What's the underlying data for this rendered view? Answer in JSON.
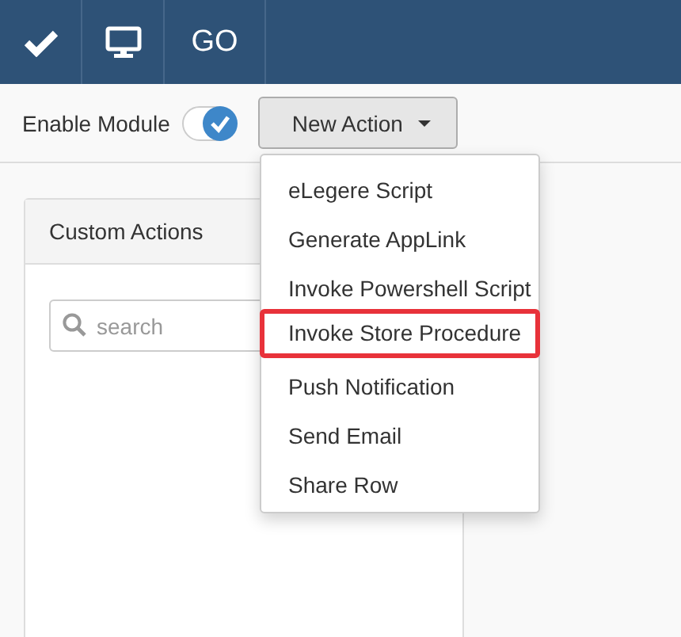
{
  "navbar": {
    "items": [
      {
        "kind": "check"
      },
      {
        "kind": "monitor"
      },
      {
        "kind": "text",
        "label": "GO"
      }
    ]
  },
  "toolbar": {
    "enable_label": "Enable Module",
    "enable_on": true,
    "new_action": "New Action"
  },
  "menu": {
    "items": [
      {
        "label": "eLegere Script",
        "highlighted": false
      },
      {
        "label": "Generate AppLink",
        "highlighted": false
      },
      {
        "label": "Invoke Powershell Script",
        "highlighted": false
      },
      {
        "label": "Invoke Store Procedure",
        "highlighted": true
      },
      {
        "label": "Push Notification",
        "highlighted": false
      },
      {
        "label": "Send Email",
        "highlighted": false
      },
      {
        "label": "Share Row",
        "highlighted": false
      }
    ]
  },
  "panel": {
    "title": "Custom Actions",
    "search": {
      "placeholder": "search"
    }
  }
}
